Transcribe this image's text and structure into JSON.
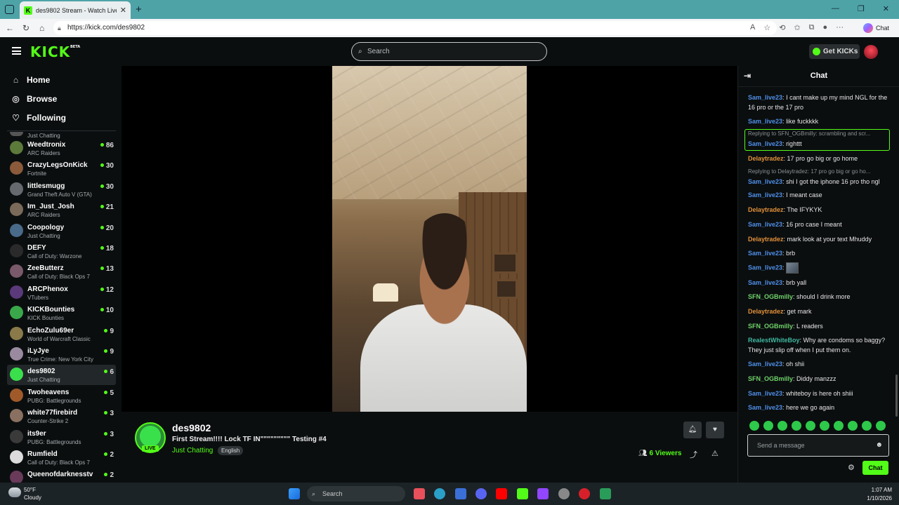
{
  "browser": {
    "tab_title": "des9802 Stream - Watch Live on K",
    "url": "https://kick.com/des9802",
    "copilot_label": "Chat"
  },
  "header": {
    "logo": "KICK",
    "logo_badge": "BETA",
    "search_placeholder": "Search",
    "get_kicks": "Get KICKs"
  },
  "sidebar": {
    "nav": [
      {
        "label": "Home",
        "icon": "home-icon"
      },
      {
        "label": "Browse",
        "icon": "compass-icon"
      },
      {
        "label": "Following",
        "icon": "heart-icon"
      }
    ],
    "partial_category": "Just Chatting",
    "channels": [
      {
        "name": "Weedtronix",
        "category": "ARC Raiders",
        "viewers": "86",
        "color": "#5c7a3a"
      },
      {
        "name": "CrazyLegsOnKick",
        "category": "Fortnite",
        "viewers": "30",
        "color": "#8a5a3a"
      },
      {
        "name": "littlesmugg",
        "category": "Grand Theft Auto V (GTA)",
        "viewers": "30",
        "color": "#666a6e"
      },
      {
        "name": "Im_Just_Josh",
        "category": "ARC Raiders",
        "viewers": "21",
        "color": "#7a6a5a"
      },
      {
        "name": "Coopology",
        "category": "Just Chatting",
        "viewers": "20",
        "color": "#4a6a8a"
      },
      {
        "name": "DEFY",
        "category": "Call of Duty: Warzone",
        "viewers": "18",
        "color": "#2a2a2a"
      },
      {
        "name": "ZeeButterz",
        "category": "Call of Duty: Black Ops 7",
        "viewers": "13",
        "color": "#7a5a6a"
      },
      {
        "name": "ARCPhenox",
        "category": "VTubers",
        "viewers": "12",
        "color": "#5a3a7a"
      },
      {
        "name": "KICKBounties",
        "category": "KICK Bounties",
        "viewers": "10",
        "color": "#3aa84a"
      },
      {
        "name": "EchoZulu69er",
        "category": "World of Warcraft Classic",
        "viewers": "9",
        "color": "#8a7a4a"
      },
      {
        "name": "iLyJye",
        "category": "True Crime: New York City",
        "viewers": "9",
        "color": "#9a8aa0"
      },
      {
        "name": "des9802",
        "category": "Just Chatting",
        "viewers": "6",
        "color": "#3ae04b"
      },
      {
        "name": "Twoheavens",
        "category": "PUBG: Battlegrounds",
        "viewers": "5",
        "color": "#a05a2a"
      },
      {
        "name": "white77firebird",
        "category": "Counter-Strike 2",
        "viewers": "3",
        "color": "#8a7060"
      },
      {
        "name": "its9er",
        "category": "PUBG: Battlegrounds",
        "viewers": "3",
        "color": "#3a3a3a"
      },
      {
        "name": "Rumfield",
        "category": "Call of Duty: Black Ops 7",
        "viewers": "2",
        "color": "#dcdcdc"
      },
      {
        "name": "Queenofdarknesstv",
        "category": "",
        "viewers": "2",
        "color": "#6a3a5a"
      }
    ]
  },
  "stream": {
    "channel": "des9802",
    "title": "First Stream!!!! Lock TF IN\"\"\"\"\"\"\"\"\" Testing #4",
    "category": "Just Chatting",
    "tag": "English",
    "live_label": "LIVE",
    "viewers_count": "6",
    "viewers_label": "Viewers"
  },
  "chat": {
    "title": "Chat",
    "messages": [
      {
        "user": "Sam_live23",
        "color": "#4f8fe8",
        "text": "I cant make up my mind NGL for the 16 pro or the 17 pro"
      },
      {
        "user": "Sam_live23",
        "color": "#4f8fe8",
        "text": "like fuckkkk"
      },
      {
        "reply": "Replying to SFN_OGBmilly: scrambling and scr...",
        "user": "Sam_live23",
        "color": "#4f8fe8",
        "text": "righttt"
      },
      {
        "user": "Delaytradez",
        "color": "#e0903a",
        "text": "17 pro go big or go home"
      },
      {
        "reply": "Replying to Delaytradez: 17 pro go big or go ho...",
        "user": "Sam_live23",
        "color": "#4f8fe8",
        "text": "shi I got the iphone 16 pro tho ngl"
      },
      {
        "user": "Sam_live23",
        "color": "#4f8fe8",
        "text": "I meant case"
      },
      {
        "user": "Delaytradez",
        "color": "#e0903a",
        "text": "The IFYKYK"
      },
      {
        "user": "Sam_live23",
        "color": "#4f8fe8",
        "text": "16 pro case I meant"
      },
      {
        "user": "Delaytradez",
        "color": "#e0903a",
        "text": "mark look at your text Mhuddy"
      },
      {
        "user": "Sam_live23",
        "color": "#4f8fe8",
        "text": "brb"
      },
      {
        "user": "Sam_live23",
        "color": "#4f8fe8",
        "text": "",
        "emote": true
      },
      {
        "user": "Sam_live23",
        "color": "#4f8fe8",
        "text": "brb yall"
      },
      {
        "user": "SFN_OGBmilly",
        "color": "#6fd36a",
        "text": "should I drink more"
      },
      {
        "user": "Delaytradez",
        "color": "#e0903a",
        "text": "get mark"
      },
      {
        "user": "SFN_OGBmilly",
        "color": "#6fd36a",
        "text": "L readers"
      },
      {
        "user": "RealestWhiteBoy",
        "color": "#3fb8a0",
        "text": "Why are condoms so baggy? They just slip off when I put them on."
      },
      {
        "user": "Sam_live23",
        "color": "#4f8fe8",
        "text": "oh shii"
      },
      {
        "user": "SFN_OGBmilly",
        "color": "#6fd36a",
        "text": "Diddy manzzz"
      },
      {
        "user": "Sam_live23",
        "color": "#4f8fe8",
        "text": "whiteboy is here oh shiii"
      },
      {
        "user": "Sam_live23",
        "color": "#4f8fe8",
        "text": "here we go again"
      }
    ],
    "input_placeholder": "Send a message",
    "send_label": "Chat"
  },
  "taskbar": {
    "temp": "50°F",
    "weather": "Cloudy",
    "search": "Search",
    "time": "1:07 AM",
    "date": "1/10/2026"
  }
}
